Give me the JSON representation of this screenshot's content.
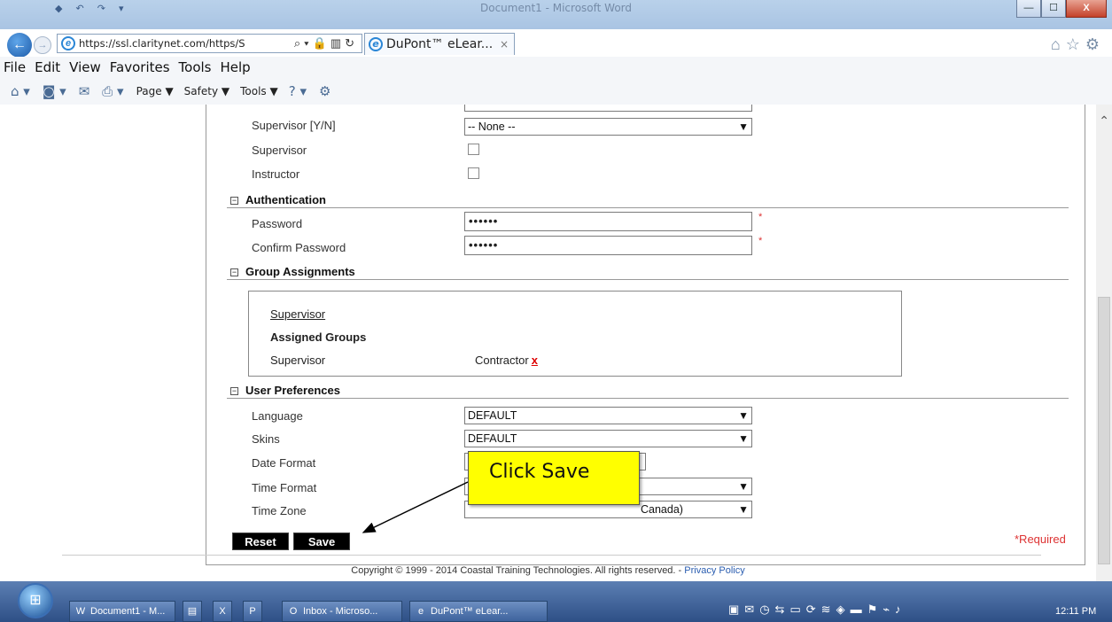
{
  "window": {
    "title": "Document1 - Microsoft Word",
    "controls": {
      "minimize": "—",
      "maximize": "☐",
      "close": "X"
    }
  },
  "browser": {
    "url": "https://ssl.claritynet.com/https/S",
    "tab_label": "DuPont™ eLear...",
    "tab_close": "×",
    "menu": [
      "File",
      "Edit",
      "View",
      "Favorites",
      "Tools",
      "Help"
    ],
    "commands": {
      "page": "Page ▼",
      "safety": "Safety ▼",
      "tools": "Tools ▼"
    }
  },
  "form": {
    "supervisor_yn": {
      "label": "Supervisor [Y/N]",
      "value": "-- None --"
    },
    "supervisor": {
      "label": "Supervisor",
      "checked": false
    },
    "instructor": {
      "label": "Instructor",
      "checked": false
    },
    "authentication": {
      "title": "Authentication",
      "password_label": "Password",
      "password_value": "••••••",
      "confirm_label": "Confirm Password",
      "confirm_value": "••••••",
      "required_mark": "*"
    },
    "groups": {
      "title": "Group Assignments",
      "link": "Supervisor",
      "assigned_heading": "Assigned Groups",
      "row_label": "Supervisor",
      "row_value": "Contractor",
      "remove": "x"
    },
    "preferences": {
      "title": "User Preferences",
      "language_label": "Language",
      "language_value": "DEFAULT",
      "skins_label": "Skins",
      "skins_value": "DEFAULT",
      "date_format_label": "Date Format",
      "time_format_label": "Time Format",
      "time_zone_label": "Time Zone",
      "time_zone_value": "Canada)"
    },
    "buttons": {
      "reset": "Reset",
      "save": "Save"
    },
    "required_note": "*Required"
  },
  "callout": {
    "text": "Click Save"
  },
  "footer": {
    "copyright": "Copyright © 1999 - 2014 Coastal Training Technologies. All rights reserved. - ",
    "privacy": "Privacy Policy"
  },
  "taskbar": {
    "items": [
      "Document1 - M...",
      "Inbox - Microso...",
      "DuPont™ eLear..."
    ],
    "clock": "12:11 PM"
  }
}
